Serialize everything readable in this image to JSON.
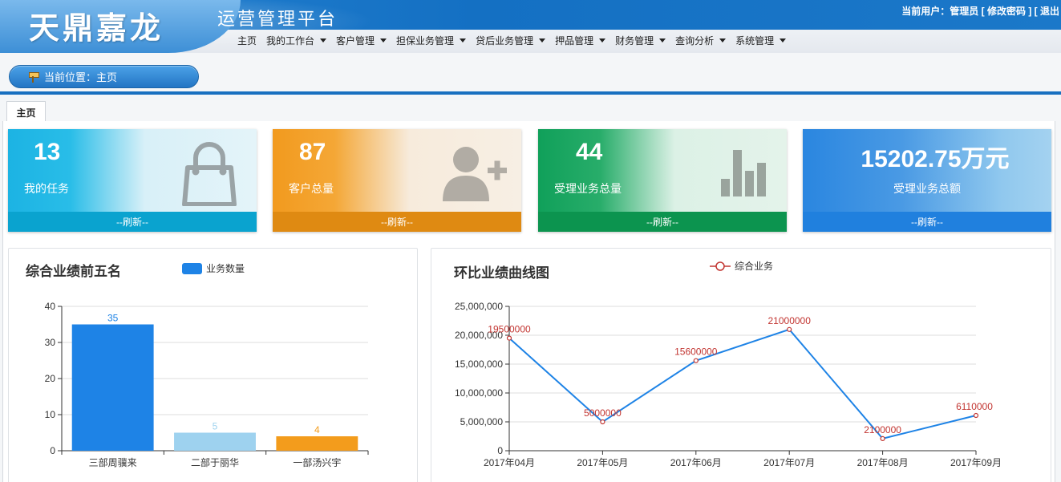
{
  "header": {
    "logo": "天鼎嘉龙",
    "platform": "运营管理平台",
    "user_prefix": "当前用户：",
    "user_name": "管理员",
    "change_password": "修改密码",
    "logout": "退出"
  },
  "nav": {
    "items": [
      {
        "label": "主页",
        "dropdown": false
      },
      {
        "label": "我的工作台",
        "dropdown": true
      },
      {
        "label": "客户管理",
        "dropdown": true
      },
      {
        "label": "担保业务管理",
        "dropdown": true
      },
      {
        "label": "贷后业务管理",
        "dropdown": true
      },
      {
        "label": "押品管理",
        "dropdown": true
      },
      {
        "label": "财务管理",
        "dropdown": true
      },
      {
        "label": "查询分析",
        "dropdown": true
      },
      {
        "label": "系统管理",
        "dropdown": true
      }
    ]
  },
  "breadcrumb": {
    "text": "当前位置：主页"
  },
  "tabs": [
    {
      "label": "主页"
    }
  ],
  "cards": [
    {
      "value": "13",
      "label": "我的任务",
      "footer": "--刷新--",
      "icon": "shopping-bag-icon",
      "color": "#1fb6e2",
      "foot_color": "#0aa3cf"
    },
    {
      "value": "87",
      "label": "客户总量",
      "footer": "--刷新--",
      "icon": "add-user-icon",
      "color": "#f29a1e",
      "foot_color": "#df8a12"
    },
    {
      "value": "44",
      "label": "受理业务总量",
      "footer": "--刷新--",
      "icon": "bar-chart-icon",
      "color": "#12a05a",
      "foot_color": "#0c944f"
    },
    {
      "value": "15202.75万元",
      "label": "受理业务总额",
      "footer": "--刷新--",
      "icon": "none",
      "color": "#2a86e0",
      "foot_color": "#2080de"
    }
  ],
  "chart_data": [
    {
      "type": "bar",
      "title": "综合业绩前五名",
      "legend": [
        "业务数量"
      ],
      "categories": [
        "三部周骥来",
        "二部于丽华",
        "一部汤兴宇"
      ],
      "series": [
        {
          "name": "业务数量",
          "values": [
            35,
            5,
            4
          ]
        }
      ],
      "bar_colors": [
        "#1e83e6",
        "#9ed2ef",
        "#f39c1c"
      ],
      "ylim": [
        0,
        40
      ],
      "yticks": [
        0,
        10,
        20,
        30,
        40
      ],
      "grid": true,
      "legend_position": "top"
    },
    {
      "type": "line",
      "title": "环比业绩曲线图",
      "legend": [
        "综合业务"
      ],
      "categories": [
        "2017年04月",
        "2017年05月",
        "2017年06月",
        "2017年07月",
        "2017年08月",
        "2017年09月"
      ],
      "series": [
        {
          "name": "综合业务",
          "values": [
            19500000,
            5000000,
            15600000,
            21000000,
            2100000,
            6110000
          ]
        }
      ],
      "line_color": "#1e83e6",
      "marker_color": "#c23531",
      "ylim": [
        0,
        25000000
      ],
      "yticks": [
        "0",
        "5,000,000",
        "10,000,000",
        "15,000,000",
        "20,000,000",
        "25,000,000"
      ],
      "grid": true,
      "legend_position": "top"
    }
  ]
}
